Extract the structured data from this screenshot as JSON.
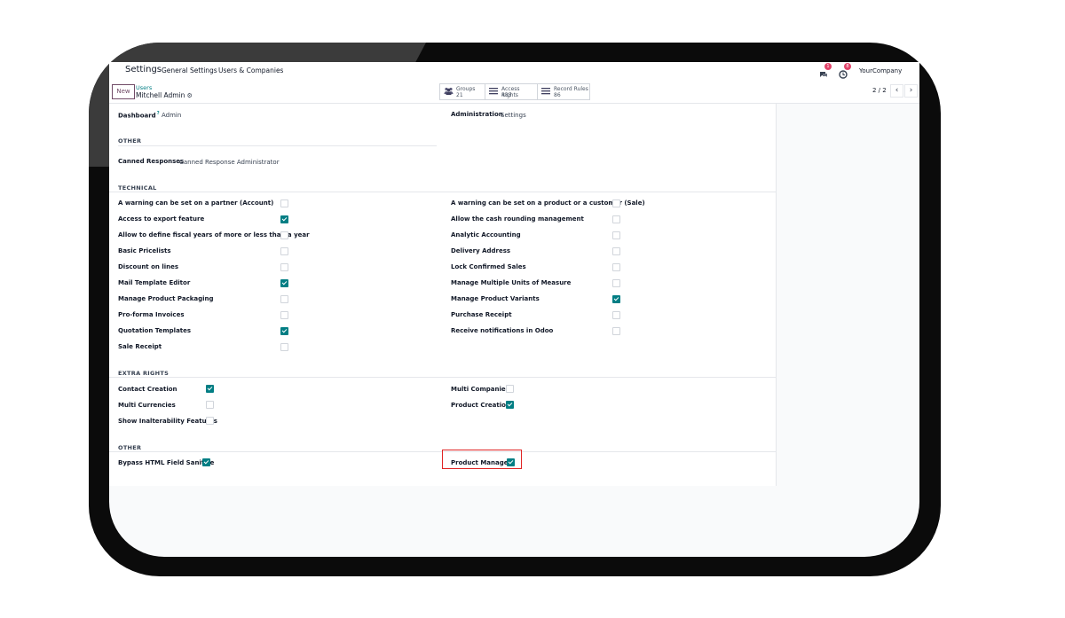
{
  "topbar": {
    "title": "Settings",
    "menu": [
      "General Settings",
      "Users & Companies"
    ],
    "chat_badge": "1",
    "activity_badge": "8",
    "company": "YourCompany"
  },
  "control": {
    "new_label": "New",
    "breadcrumb_parent": "Users",
    "breadcrumb_current": "Mitchell Admin",
    "smart_buttons": [
      {
        "label": "Groups",
        "count": "21",
        "icon": "users-icon"
      },
      {
        "label": "Access Rights",
        "count": "483",
        "icon": "list-icon"
      },
      {
        "label": "Record Rules",
        "count": "86",
        "icon": "list-icon"
      }
    ],
    "pager": "2 / 2"
  },
  "form": {
    "dashboard_label": "Dashboard",
    "dashboard_help": "?",
    "dashboard_value": "Admin",
    "administration_label": "Administration",
    "administration_value": "Settings",
    "other1_title": "OTHER",
    "canned_label": "Canned Responses",
    "canned_value": "Canned Response Administrator",
    "technical_title": "TECHNICAL",
    "technical_left": [
      {
        "label": "A warning can be set on a partner (Account)",
        "checked": false
      },
      {
        "label": "Access to export feature",
        "checked": true
      },
      {
        "label": "Allow to define fiscal years of more or less than a year",
        "checked": false
      },
      {
        "label": "Basic Pricelists",
        "checked": false
      },
      {
        "label": "Discount on lines",
        "checked": false
      },
      {
        "label": "Mail Template Editor",
        "checked": true
      },
      {
        "label": "Manage Product Packaging",
        "checked": false
      },
      {
        "label": "Pro-forma Invoices",
        "checked": false
      },
      {
        "label": "Quotation Templates",
        "checked": true
      },
      {
        "label": "Sale Receipt",
        "checked": false
      }
    ],
    "technical_right": [
      {
        "label": "A warning can be set on a product or a customer (Sale)",
        "checked": false
      },
      {
        "label": "Allow the cash rounding management",
        "checked": false
      },
      {
        "label": "Analytic Accounting",
        "checked": false
      },
      {
        "label": "Delivery Address",
        "checked": false
      },
      {
        "label": "Lock Confirmed Sales",
        "checked": false
      },
      {
        "label": "Manage Multiple Units of Measure",
        "checked": false
      },
      {
        "label": "Manage Product Variants",
        "checked": true
      },
      {
        "label": "Purchase Receipt",
        "checked": false
      },
      {
        "label": "Receive notifications in Odoo",
        "checked": false
      }
    ],
    "extra_title": "EXTRA RIGHTS",
    "extra_left": [
      {
        "label": "Contact Creation",
        "checked": true
      },
      {
        "label": "Multi Currencies",
        "checked": false
      },
      {
        "label": "Show Inalterability Features",
        "checked": false
      }
    ],
    "extra_right": [
      {
        "label": "Multi Companies",
        "checked": false
      },
      {
        "label": "Product Creation",
        "checked": true
      }
    ],
    "other2_title": "OTHER",
    "bypass_label": "Bypass HTML Field Sanitize",
    "bypass_checked": true,
    "product_manager_label": "Product Manager",
    "product_manager_checked": true
  },
  "colors": {
    "accent": "#017e84",
    "brand": "#714b67",
    "highlight": "#e02424"
  }
}
